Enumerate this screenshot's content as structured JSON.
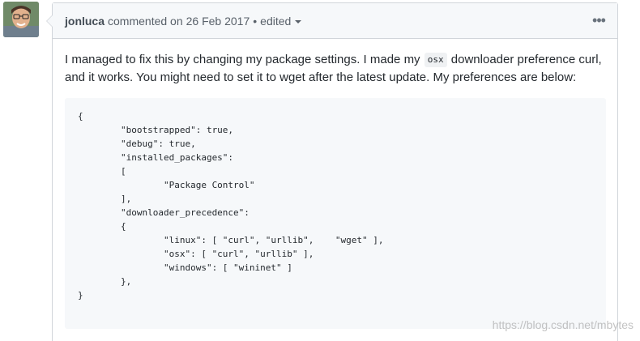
{
  "comment": {
    "author": "jonluca",
    "action": "commented on",
    "date": "26 Feb 2017",
    "separator": "•",
    "edited_label": "edited",
    "more_icon": "kebab-horizontal-icon"
  },
  "body": {
    "text_before_code": "I managed to fix this by changing my package settings. I made my",
    "inline_code": "osx",
    "text_after_code": "downloader preference curl, and it works. You might need to set it to wget after the latest update. My preferences are below:",
    "code_block": "{\n        \"bootstrapped\": true,\n        \"debug\": true,\n        \"installed_packages\":\n        [\n                \"Package Control\"\n        ],\n        \"downloader_precedence\":\n        {\n                \"linux\": [ \"curl\", \"urllib\",    \"wget\" ],\n                \"osx\": [ \"curl\", \"urllib\" ],\n                \"windows\": [ \"wininet\" ]\n        },\n}"
  },
  "watermark": {
    "text": "https://blog.csdn.net/mbytes"
  }
}
